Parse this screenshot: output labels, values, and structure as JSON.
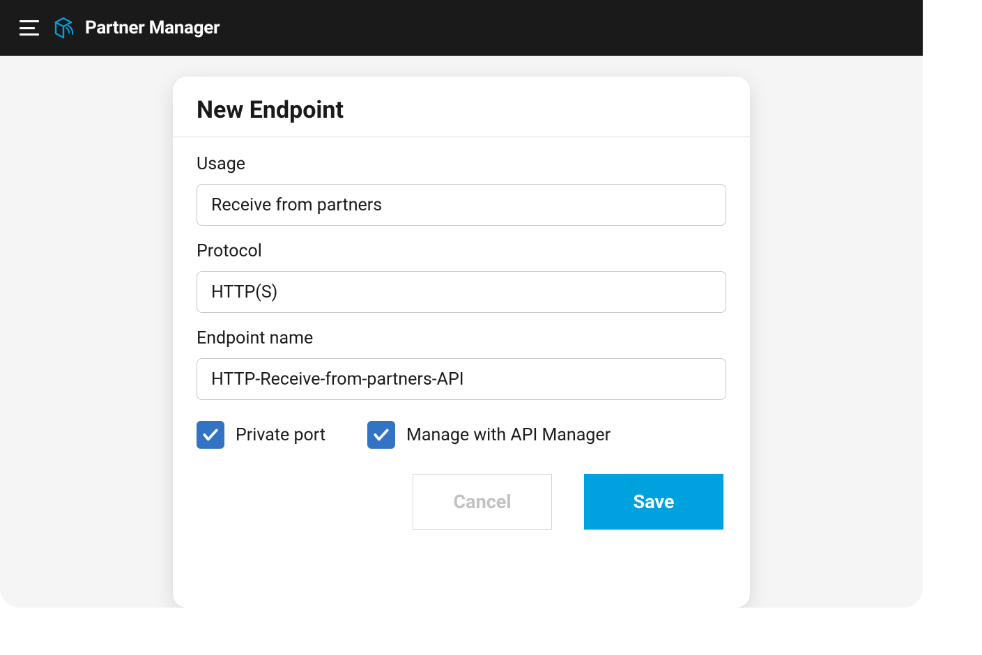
{
  "header": {
    "app_title": "Partner Manager"
  },
  "dialog": {
    "title": "New Endpoint",
    "fields": {
      "usage": {
        "label": "Usage",
        "value": "Receive from partners"
      },
      "protocol": {
        "label": "Protocol",
        "value": "HTTP(S)"
      },
      "endpoint_name": {
        "label": "Endpoint name",
        "value": "HTTP-Receive-from-partners-API"
      }
    },
    "checkboxes": {
      "private_port": {
        "label": "Private port",
        "checked": true
      },
      "manage_api": {
        "label": "Manage with API Manager",
        "checked": true
      }
    },
    "buttons": {
      "cancel": "Cancel",
      "save": "Save"
    }
  },
  "colors": {
    "accent": "#00a1df",
    "checkbox": "#3273c4",
    "header_bg": "#1a1a1a"
  }
}
